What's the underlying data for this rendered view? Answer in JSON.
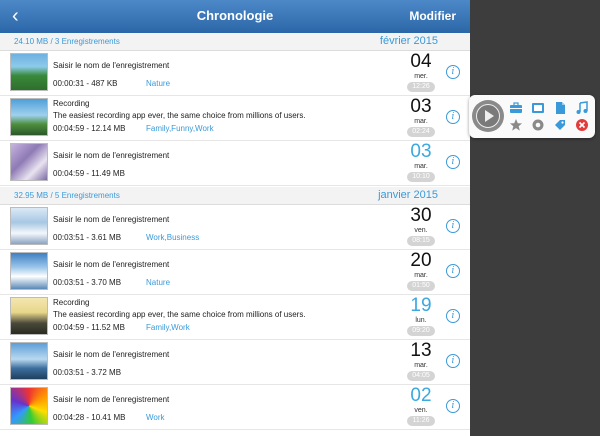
{
  "nav": {
    "back": "‹",
    "title": "Chronologie",
    "edit": "Modifier"
  },
  "sections": [
    {
      "summary": "24.10 MB / 3 Enregistrements",
      "month": "février 2015"
    },
    {
      "summary": "32.95 MB / 5 Enregistrements",
      "month": "janvier 2015"
    }
  ],
  "rows": [
    {
      "title": "Saisir le nom de l'enregistrement",
      "desc": "",
      "meta": "00:00:31 -  487 KB",
      "tags": "Nature",
      "day": "04",
      "weekday": "mer.",
      "time": "12:26",
      "highlight": false
    },
    {
      "title": "Recording",
      "desc": "The easiest recording app ever, the same choice from millions of users.",
      "meta": "00:04:59 -  12.14 MB",
      "tags": "Family,Funny,Work",
      "day": "03",
      "weekday": "mar.",
      "time": "02:24",
      "highlight": false
    },
    {
      "title": "Saisir le nom de l'enregistrement",
      "desc": "",
      "meta": "00:04:59 -  11.49 MB",
      "tags": "",
      "day": "03",
      "weekday": "mar.",
      "time": "10:10",
      "highlight": true
    },
    {
      "title": "Saisir le nom de l'enregistrement",
      "desc": "",
      "meta": "00:03:51 -  3.61 MB",
      "tags": "Work,Business",
      "day": "30",
      "weekday": "ven.",
      "time": "08:15",
      "highlight": false
    },
    {
      "title": "Saisir le nom de l'enregistrement",
      "desc": "",
      "meta": "00:03:51 -  3.70 MB",
      "tags": "Nature",
      "day": "20",
      "weekday": "mar.",
      "time": "01:50",
      "highlight": false
    },
    {
      "title": "Recording",
      "desc": "The easiest recording app ever, the same choice from millions of users.",
      "meta": "00:04:59 -  11.52 MB",
      "tags": "Family,Work",
      "day": "19",
      "weekday": "lun.",
      "time": "09:20",
      "highlight": true
    },
    {
      "title": "Saisir le nom de l'enregistrement",
      "desc": "",
      "meta": "00:03:51 -  3.72 MB",
      "tags": "",
      "day": "13",
      "weekday": "mar.",
      "time": "04:05",
      "highlight": false
    },
    {
      "title": "Saisir le nom de l'enregistrement",
      "desc": "",
      "meta": "00:04:28 -  10.41 MB",
      "tags": "Work",
      "day": "02",
      "weekday": "ven.",
      "time": "11:26",
      "highlight": true
    }
  ],
  "colors": {
    "accent": "#3a9ad9",
    "navbar": "#2b66a8",
    "day_highlight": "#3ba8e0",
    "delete": "#e33b3b"
  },
  "popup_icons": [
    "play-icon",
    "briefcase-icon",
    "film-icon",
    "document-icon",
    "music-note-icon",
    "star-icon",
    "settings-icon",
    "tag-icon",
    "delete-icon"
  ]
}
